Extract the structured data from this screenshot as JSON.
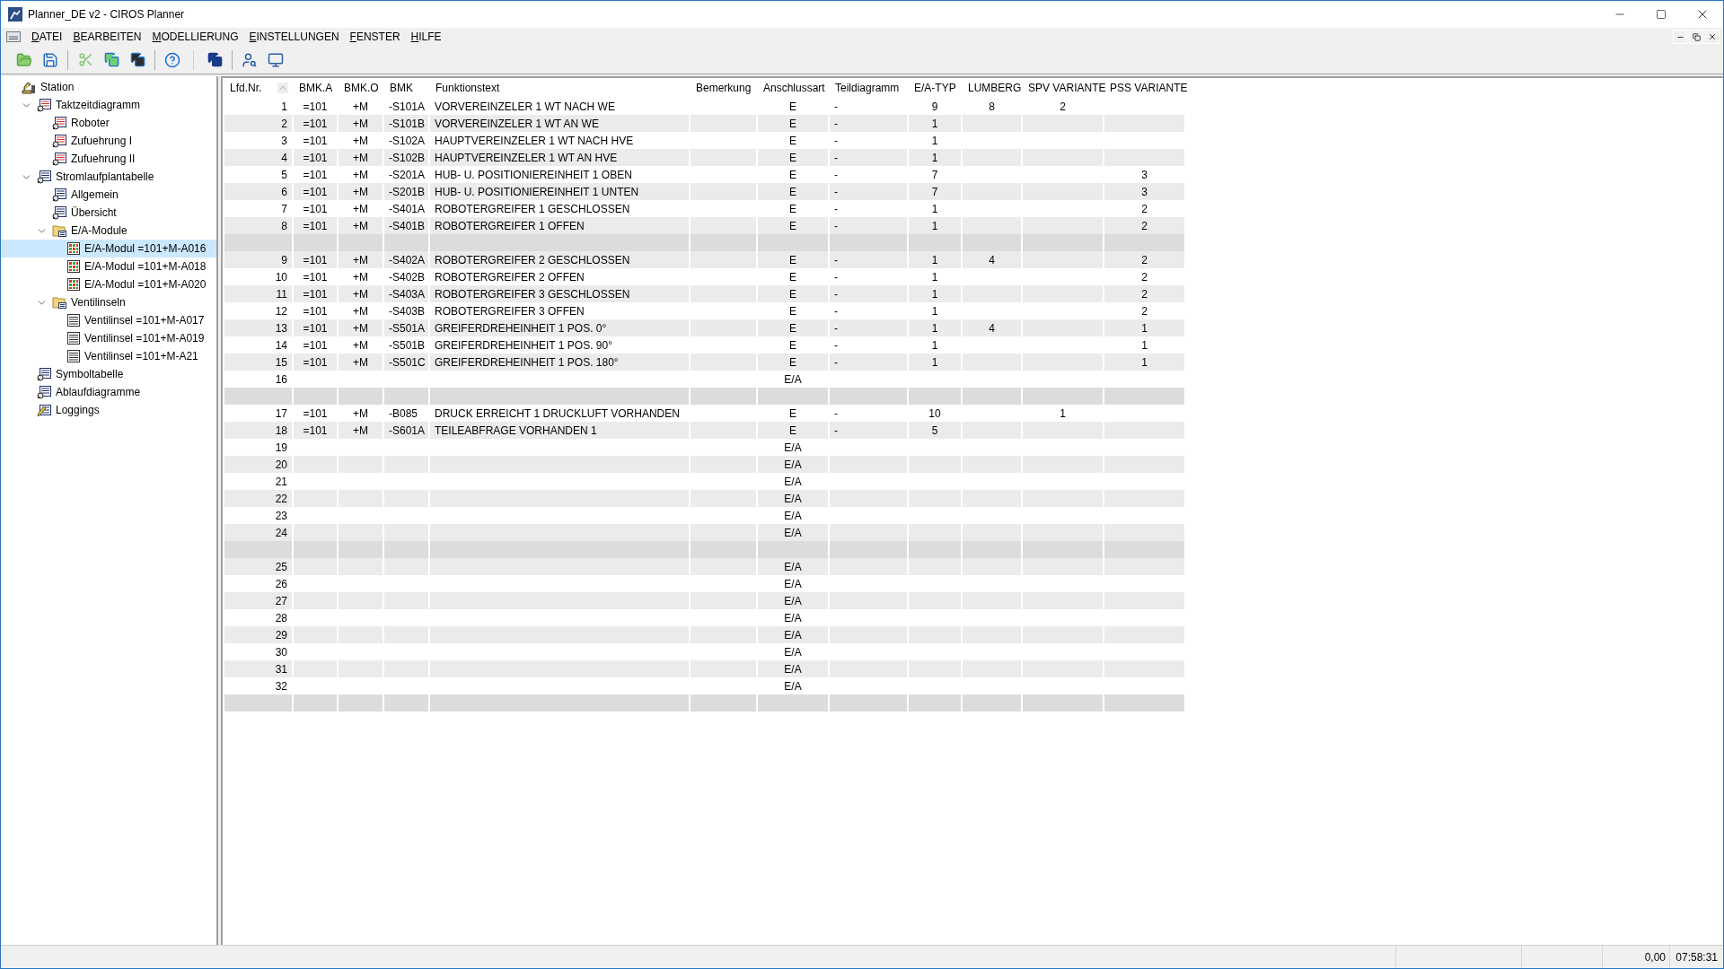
{
  "window": {
    "title": "Planner_DE v2 - CIROS Planner"
  },
  "menu": [
    "DATEI",
    "BEARBEITEN",
    "MODELLIERUNG",
    "EINSTELLUNGEN",
    "FENSTER",
    "HILFE"
  ],
  "tree": [
    {
      "label": "Station",
      "kind": "station",
      "selected": false,
      "children": [
        {
          "label": "Taktzeitdiagramm",
          "kind": "diagram",
          "selected": false,
          "expanded": true,
          "children": [
            {
              "label": "Roboter",
              "kind": "diagram",
              "selected": false
            },
            {
              "label": "Zufuehrung I",
              "kind": "diagram",
              "selected": false
            },
            {
              "label": "Zufuehrung II",
              "kind": "diagram",
              "selected": false
            }
          ]
        },
        {
          "label": "Stromlaufplantabelle",
          "kind": "table",
          "selected": false,
          "expanded": true,
          "children": [
            {
              "label": "Allgemein",
              "kind": "table",
              "selected": false
            },
            {
              "label": "Übersicht",
              "kind": "table",
              "selected": false
            },
            {
              "label": "E/A-Module",
              "kind": "folder",
              "selected": false,
              "expanded": true,
              "children": [
                {
                  "label": "E/A-Modul =101+M-A016",
                  "kind": "module",
                  "selected": true
                },
                {
                  "label": "E/A-Modul =101+M-A018",
                  "kind": "module",
                  "selected": false
                },
                {
                  "label": "E/A-Modul =101+M-A020",
                  "kind": "module",
                  "selected": false
                }
              ]
            },
            {
              "label": "Ventilinseln",
              "kind": "folder",
              "selected": false,
              "expanded": true,
              "children": [
                {
                  "label": "Ventilinsel =101+M-A017",
                  "kind": "valve",
                  "selected": false
                },
                {
                  "label": "Ventilinsel =101+M-A019",
                  "kind": "valve",
                  "selected": false
                },
                {
                  "label": "Ventilinsel =101+M-A21",
                  "kind": "valve",
                  "selected": false
                }
              ]
            }
          ]
        },
        {
          "label": "Symboltabelle",
          "kind": "table",
          "selected": false
        },
        {
          "label": "Ablaufdiagramme",
          "kind": "sequence",
          "selected": false
        },
        {
          "label": "Loggings",
          "kind": "log",
          "selected": false
        }
      ]
    }
  ],
  "table": {
    "columns": [
      "Lfd.Nr.",
      "BMK.A",
      "BMK.O",
      "BMK",
      "Funktionstext",
      "Bemerkung",
      "Anschlussart",
      "Teildiagramm",
      "E/A-TYP",
      "LUMBERG",
      "SPV VARIANTE",
      "PSS VARIANTE"
    ],
    "rows": [
      {
        "kind": "data",
        "lfd_nr": "1",
        "bmk_a": "=101",
        "bmk_o": "+M",
        "bmk": "-S101A",
        "funktionstext": "VORVEREINZELER 1 WT NACH WE",
        "anschlussart": "E",
        "teildiagramm": "-",
        "ea_typ": "9",
        "lumberg": "8",
        "spv_variante": "2"
      },
      {
        "kind": "data",
        "lfd_nr": "2",
        "bmk_a": "=101",
        "bmk_o": "+M",
        "bmk": "-S101B",
        "funktionstext": "VORVEREINZELER 1 WT AN WE",
        "anschlussart": "E",
        "teildiagramm": "-",
        "ea_typ": "1"
      },
      {
        "kind": "data",
        "lfd_nr": "3",
        "bmk_a": "=101",
        "bmk_o": "+M",
        "bmk": "-S102A",
        "funktionstext": "HAUPTVEREINZELER 1 WT NACH HVE",
        "anschlussart": "E",
        "teildiagramm": "-",
        "ea_typ": "1"
      },
      {
        "kind": "data",
        "lfd_nr": "4",
        "bmk_a": "=101",
        "bmk_o": "+M",
        "bmk": "-S102B",
        "funktionstext": "HAUPTVEREINZELER 1 WT AN HVE",
        "anschlussart": "E",
        "teildiagramm": "-",
        "ea_typ": "1"
      },
      {
        "kind": "data",
        "lfd_nr": "5",
        "bmk_a": "=101",
        "bmk_o": "+M",
        "bmk": "-S201A",
        "funktionstext": "HUB- U. POSITIONIEREINHEIT 1 OBEN",
        "anschlussart": "E",
        "teildiagramm": "-",
        "ea_typ": "7",
        "pss_variante": "3"
      },
      {
        "kind": "data",
        "lfd_nr": "6",
        "bmk_a": "=101",
        "bmk_o": "+M",
        "bmk": "-S201B",
        "funktionstext": "HUB- U. POSITIONIEREINHEIT 1 UNTEN",
        "anschlussart": "E",
        "teildiagramm": "-",
        "ea_typ": "7",
        "pss_variante": "3"
      },
      {
        "kind": "data",
        "lfd_nr": "7",
        "bmk_a": "=101",
        "bmk_o": "+M",
        "bmk": "-S401A",
        "funktionstext": "ROBOTERGREIFER 1 GESCHLOSSEN",
        "anschlussart": "E",
        "teildiagramm": "-",
        "ea_typ": "1",
        "pss_variante": "2"
      },
      {
        "kind": "data",
        "lfd_nr": "8",
        "bmk_a": "=101",
        "bmk_o": "+M",
        "bmk": "-S401B",
        "funktionstext": "ROBOTERGREIFER 1 OFFEN",
        "anschlussart": "E",
        "teildiagramm": "-",
        "ea_typ": "1",
        "pss_variante": "2"
      },
      {
        "kind": "separator"
      },
      {
        "kind": "data",
        "lfd_nr": "9",
        "bmk_a": "=101",
        "bmk_o": "+M",
        "bmk": "-S402A",
        "funktionstext": "ROBOTERGREIFER 2 GESCHLOSSEN",
        "anschlussart": "E",
        "teildiagramm": "-",
        "ea_typ": "1",
        "lumberg": "4",
        "pss_variante": "2"
      },
      {
        "kind": "data",
        "lfd_nr": "10",
        "bmk_a": "=101",
        "bmk_o": "+M",
        "bmk": "-S402B",
        "funktionstext": "ROBOTERGREIFER 2 OFFEN",
        "anschlussart": "E",
        "teildiagramm": "-",
        "ea_typ": "1",
        "pss_variante": "2"
      },
      {
        "kind": "data",
        "lfd_nr": "11",
        "bmk_a": "=101",
        "bmk_o": "+M",
        "bmk": "-S403A",
        "funktionstext": "ROBOTERGREIFER 3 GESCHLOSSEN",
        "anschlussart": "E",
        "teildiagramm": "-",
        "ea_typ": "1",
        "pss_variante": "2"
      },
      {
        "kind": "data",
        "lfd_nr": "12",
        "bmk_a": "=101",
        "bmk_o": "+M",
        "bmk": "-S403B",
        "funktionstext": "ROBOTERGREIFER 3 OFFEN",
        "anschlussart": "E",
        "teildiagramm": "-",
        "ea_typ": "1",
        "pss_variante": "2"
      },
      {
        "kind": "data",
        "lfd_nr": "13",
        "bmk_a": "=101",
        "bmk_o": "+M",
        "bmk": "-S501A",
        "funktionstext": "GREIFERDREHEINHEIT 1 POS. 0°",
        "anschlussart": "E",
        "teildiagramm": "-",
        "ea_typ": "1",
        "lumberg": "4",
        "pss_variante": "1"
      },
      {
        "kind": "data",
        "lfd_nr": "14",
        "bmk_a": "=101",
        "bmk_o": "+M",
        "bmk": "-S501B",
        "funktionstext": "GREIFERDREHEINHEIT 1 POS. 90°",
        "anschlussart": "E",
        "teildiagramm": "-",
        "ea_typ": "1",
        "pss_variante": "1"
      },
      {
        "kind": "data",
        "lfd_nr": "15",
        "bmk_a": "=101",
        "bmk_o": "+M",
        "bmk": "-S501C",
        "funktionstext": "GREIFERDREHEINHEIT 1 POS. 180°",
        "anschlussart": "E",
        "teildiagramm": "-",
        "ea_typ": "1",
        "pss_variante": "1"
      },
      {
        "kind": "data",
        "lfd_nr": "16",
        "anschlussart": "E/A"
      },
      {
        "kind": "separator"
      },
      {
        "kind": "data",
        "lfd_nr": "17",
        "bmk_a": "=101",
        "bmk_o": "+M",
        "bmk": "-B085",
        "funktionstext": "DRUCK ERREICHT 1 DRUCKLUFT VORHANDEN",
        "anschlussart": "E",
        "teildiagramm": "-",
        "ea_typ": "10",
        "spv_variante": "1"
      },
      {
        "kind": "data",
        "lfd_nr": "18",
        "bmk_a": "=101",
        "bmk_o": "+M",
        "bmk": "-S601A",
        "funktionstext": "TEILEABFRAGE VORHANDEN 1",
        "anschlussart": "E",
        "teildiagramm": "-",
        "ea_typ": "5"
      },
      {
        "kind": "data",
        "lfd_nr": "19",
        "anschlussart": "E/A"
      },
      {
        "kind": "data",
        "lfd_nr": "20",
        "anschlussart": "E/A"
      },
      {
        "kind": "data",
        "lfd_nr": "21",
        "anschlussart": "E/A"
      },
      {
        "kind": "data",
        "lfd_nr": "22",
        "anschlussart": "E/A"
      },
      {
        "kind": "data",
        "lfd_nr": "23",
        "anschlussart": "E/A"
      },
      {
        "kind": "data",
        "lfd_nr": "24",
        "anschlussart": "E/A"
      },
      {
        "kind": "separator"
      },
      {
        "kind": "data",
        "lfd_nr": "25",
        "anschlussart": "E/A"
      },
      {
        "kind": "data",
        "lfd_nr": "26",
        "anschlussart": "E/A"
      },
      {
        "kind": "data",
        "lfd_nr": "27",
        "anschlussart": "E/A"
      },
      {
        "kind": "data",
        "lfd_nr": "28",
        "anschlussart": "E/A"
      },
      {
        "kind": "data",
        "lfd_nr": "29",
        "anschlussart": "E/A"
      },
      {
        "kind": "data",
        "lfd_nr": "30",
        "anschlussart": "E/A"
      },
      {
        "kind": "data",
        "lfd_nr": "31",
        "anschlussart": "E/A"
      },
      {
        "kind": "data",
        "lfd_nr": "32",
        "anschlussart": "E/A"
      },
      {
        "kind": "separator"
      }
    ]
  },
  "status_bar": {
    "value": "0,00",
    "time": "07:58:31"
  }
}
